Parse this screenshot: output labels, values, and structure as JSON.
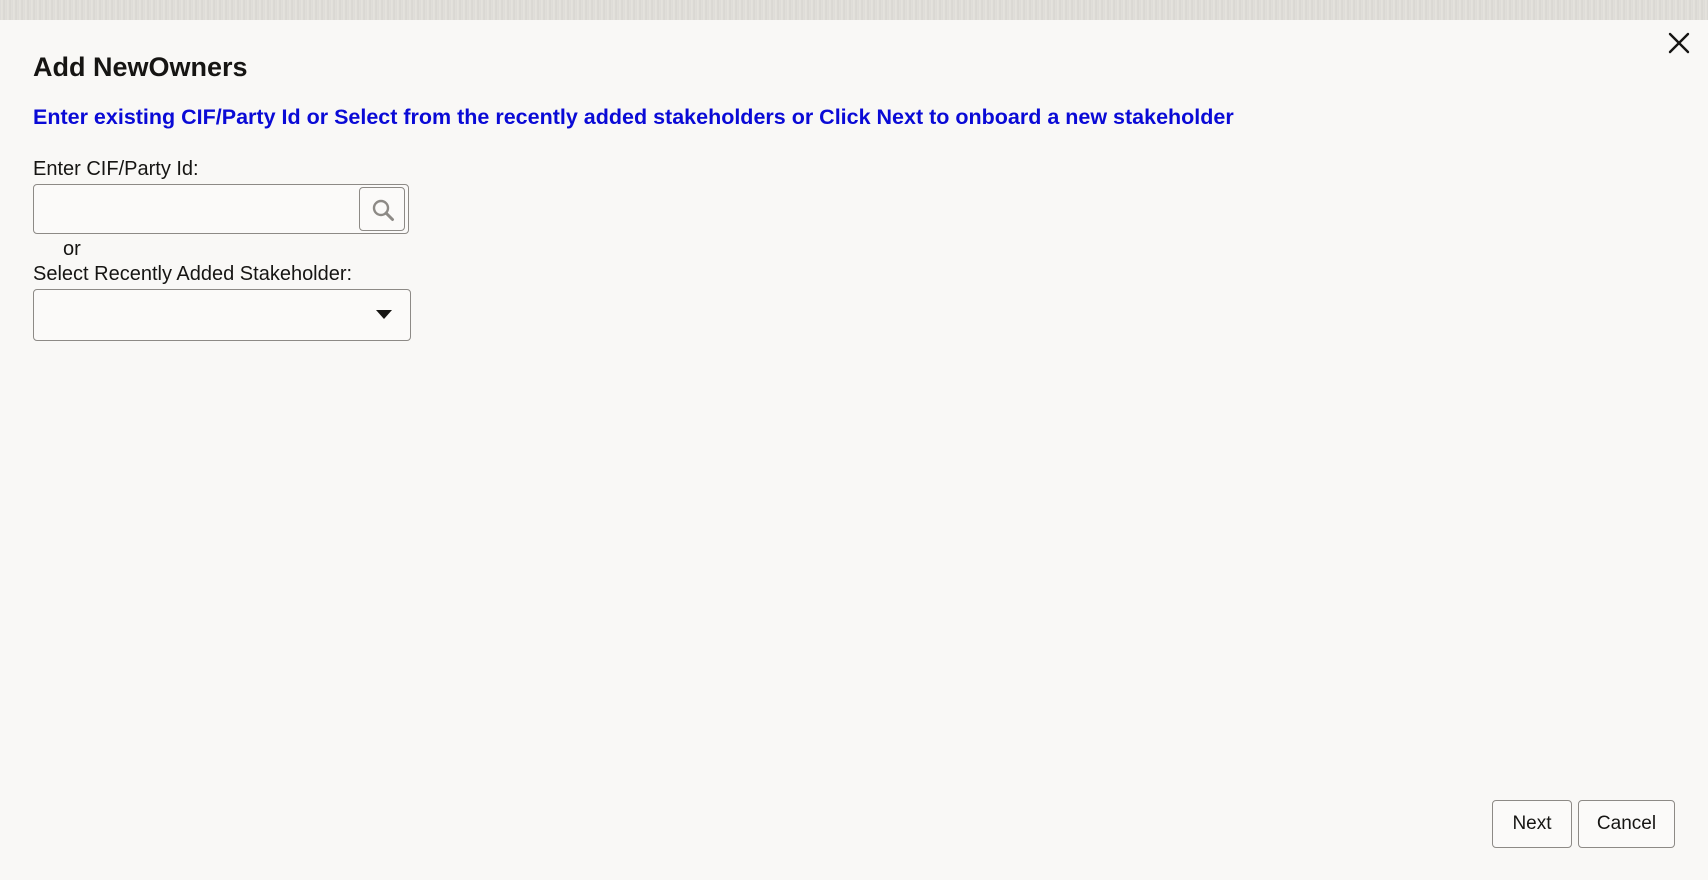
{
  "dialog": {
    "title": "Add NewOwners",
    "instruction": "Enter existing CIF/Party Id or Select from the recently added stakeholders or Click Next to onboard a new stakeholder",
    "close_icon": "close-icon"
  },
  "cif": {
    "label": "Enter CIF/Party Id:",
    "value": "",
    "placeholder": "",
    "search_icon": "search-icon"
  },
  "separator": {
    "text": "or"
  },
  "stakeholder": {
    "label": "Select Recently Added Stakeholder:",
    "selected": "",
    "dropdown_icon": "caret-down-icon"
  },
  "footer": {
    "next_label": "Next",
    "cancel_label": "Cancel"
  },
  "colors": {
    "background": "#f9f8f6",
    "instruction_text": "#0a0ad6",
    "text": "#161513",
    "border": "#8d8a86"
  }
}
